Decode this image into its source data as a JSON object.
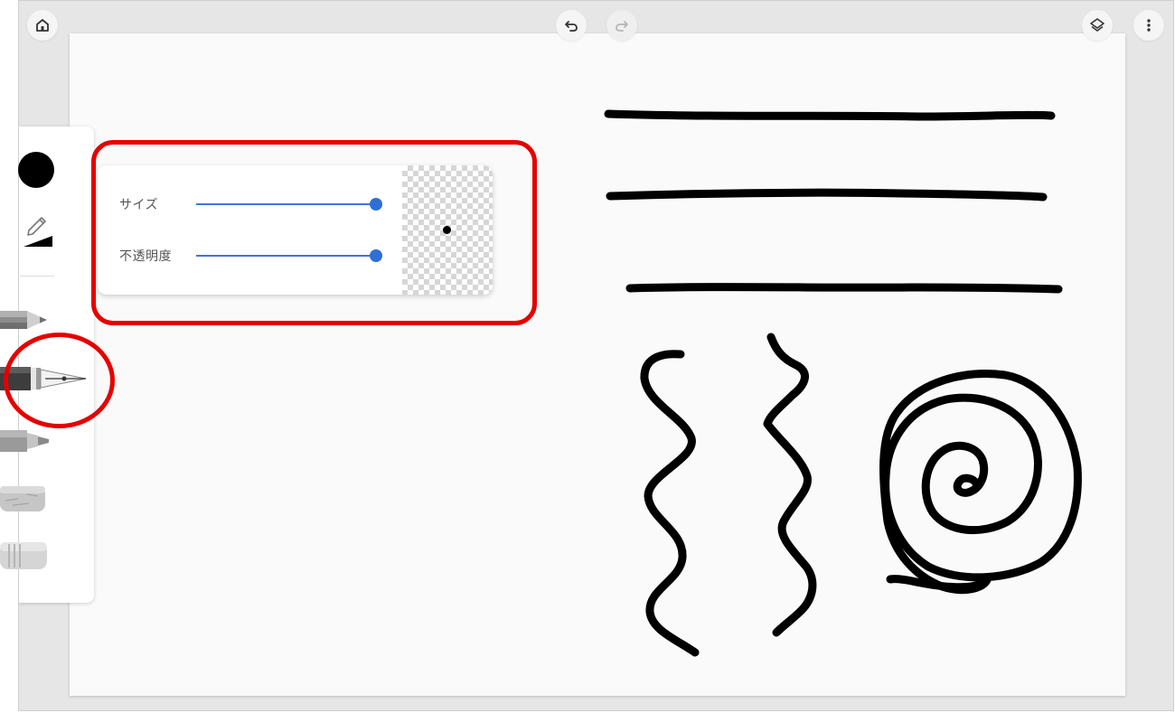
{
  "top_bar": {
    "home_icon": "home-icon",
    "undo_icon": "undo-icon",
    "redo_icon": "redo-icon",
    "layers_icon": "layers-icon",
    "more_icon": "more-vert-icon"
  },
  "toolbar": {
    "selected_color": "#000000",
    "tools": [
      "pencil",
      "pen",
      "marker",
      "chalk",
      "eraser"
    ],
    "selected_tool": "pen"
  },
  "brush_panel": {
    "size_label": "サイズ",
    "opacity_label": "不透明度",
    "size_value": 1.0,
    "opacity_value": 1.0,
    "accent_color": "#2e6fd8"
  },
  "annotations": {
    "highlight_color": "#e60000"
  }
}
